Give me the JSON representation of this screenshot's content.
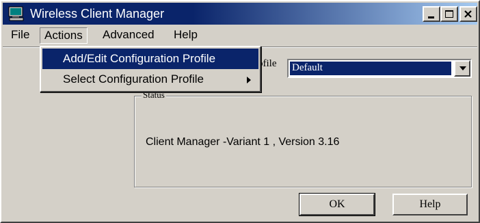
{
  "window": {
    "title": "Wireless Client Manager",
    "controls": {
      "minimize": "minimize",
      "maximize": "maximize",
      "close": "close"
    }
  },
  "menubar": {
    "items": [
      "File",
      "Actions",
      "Advanced",
      "Help"
    ],
    "open_menu": "Actions"
  },
  "actions_menu": {
    "items": [
      {
        "label": "Add/Edit Configuration Profile",
        "highlighted": true,
        "submenu": false
      },
      {
        "label": "Select Configuration Profile",
        "highlighted": false,
        "submenu": true
      }
    ]
  },
  "profile": {
    "label": "rofile",
    "selected": "Default"
  },
  "status": {
    "legend": "Status",
    "text": "Client Manager -Variant 1 , Version 3.16"
  },
  "buttons": {
    "ok": "OK",
    "help": "Help"
  },
  "colors": {
    "face": "#d4d0c8",
    "titlebar_start": "#0a246a",
    "titlebar_end": "#a6caf0",
    "highlight": "#0a246a"
  },
  "icons": {
    "app": "computer-monitor-icon",
    "submenu": "triangle-right-icon",
    "dropdown": "triangle-down-icon"
  }
}
